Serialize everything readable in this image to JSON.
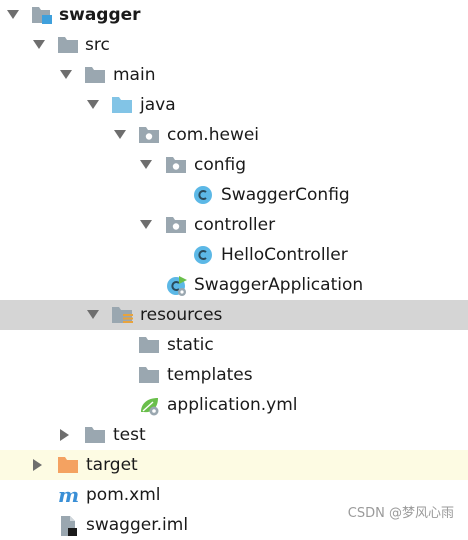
{
  "project_tree": {
    "root": {
      "label": "swagger"
    },
    "src": {
      "label": "src"
    },
    "main": {
      "label": "main"
    },
    "java": {
      "label": "java"
    },
    "package": {
      "label": "com.hewei"
    },
    "config": {
      "label": "config"
    },
    "swagger_config": {
      "label": "SwaggerConfig"
    },
    "controller": {
      "label": "controller"
    },
    "hello_controller": {
      "label": "HelloController"
    },
    "swagger_application": {
      "label": "SwaggerApplication"
    },
    "resources": {
      "label": "resources"
    },
    "static": {
      "label": "static"
    },
    "templates": {
      "label": "templates"
    },
    "application_yml": {
      "label": "application.yml"
    },
    "test": {
      "label": "test"
    },
    "target": {
      "label": "target"
    },
    "pom_xml": {
      "label": "pom.xml"
    },
    "swagger_iml": {
      "label": "swagger.iml"
    }
  },
  "watermark": {
    "text": "CSDN @梦风心雨"
  },
  "colors": {
    "folder": "#9aa7b0",
    "source_root": "#82c4e6",
    "excluded_folder": "#f4a261",
    "class_icon": "#5cb8e6",
    "maven_icon": "#3a8fd6",
    "selection": "#d5d5d5",
    "excluded_row": "#fdfbe3"
  }
}
